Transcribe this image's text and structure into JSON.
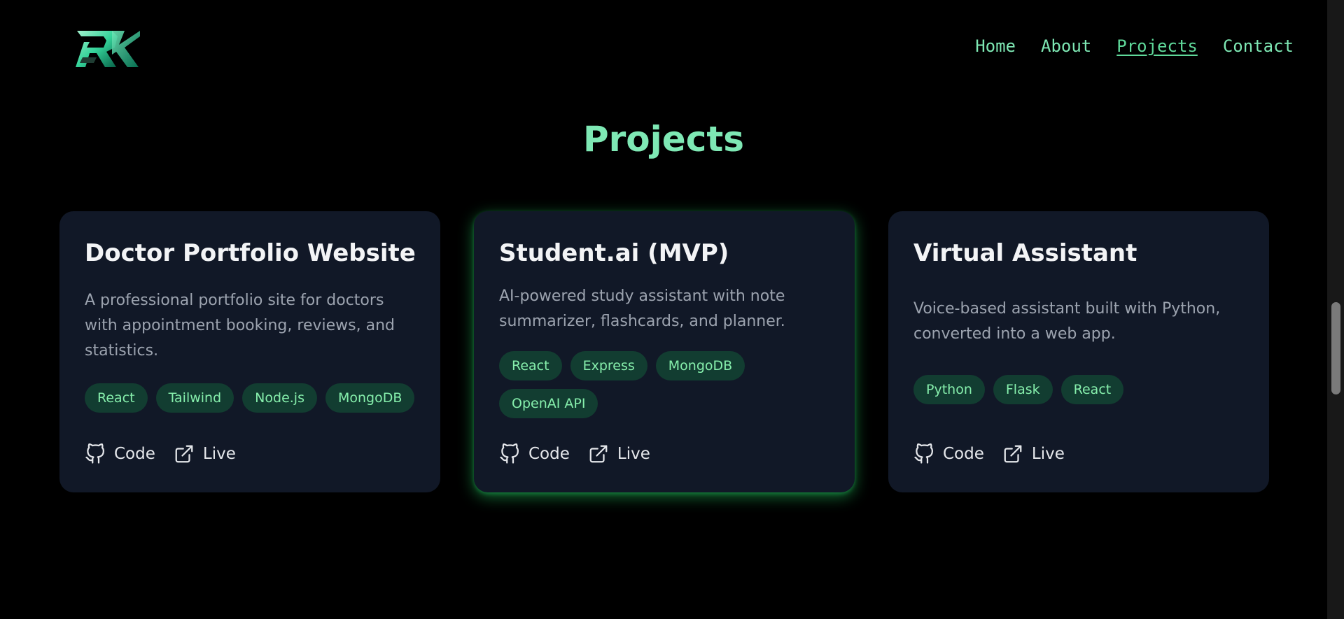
{
  "header": {
    "logo_text": "RK",
    "nav": [
      {
        "label": "Home",
        "active": false
      },
      {
        "label": "About",
        "active": false
      },
      {
        "label": "Projects",
        "active": true
      },
      {
        "label": "Contact",
        "active": false
      }
    ]
  },
  "section": {
    "title": "Projects"
  },
  "projects": [
    {
      "title": "Doctor Portfolio Website",
      "description": "A professional portfolio site for doctors with appointment booking, reviews, and statistics.",
      "tags": [
        "React",
        "Tailwind",
        "Node.js",
        "MongoDB"
      ],
      "code_label": "Code",
      "live_label": "Live"
    },
    {
      "title": "Student.ai (MVP)",
      "description": "AI-powered study assistant with note summarizer, flashcards, and planner.",
      "tags": [
        "React",
        "Express",
        "MongoDB",
        "OpenAI API"
      ],
      "code_label": "Code",
      "live_label": "Live"
    },
    {
      "title": "Virtual Assistant",
      "description": "Voice-based assistant built with Python, converted into a web app.",
      "tags": [
        "Python",
        "Flask",
        "React"
      ],
      "code_label": "Code",
      "live_label": "Live"
    }
  ],
  "colors": {
    "background": "#000000",
    "accent": "#7ee8b4",
    "card_bg": "#111827",
    "tag_bg": "#123d31",
    "tag_text": "#86efac",
    "glow": "#22c55e"
  },
  "icons": {
    "code": "github-icon",
    "live": "external-link-icon"
  }
}
